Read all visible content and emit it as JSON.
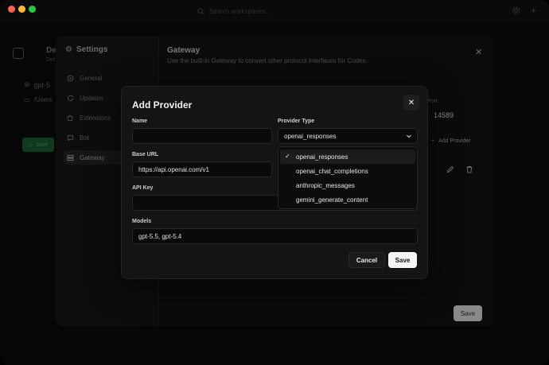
{
  "titlebar": {
    "search_placeholder": "Search workspaces...",
    "icons": [
      "search-icon",
      "gear-icon",
      "plus-icon"
    ]
  },
  "workspace": {
    "title": "De",
    "subtitle": "Def",
    "branch": "gpt-5",
    "path": "/Users",
    "start_label": "Start"
  },
  "settings": {
    "title": "Settings",
    "nav": [
      "General",
      "Updates",
      "Extensions",
      "Bot",
      "Gateway"
    ],
    "active": "Gateway"
  },
  "gateway": {
    "title": "Gateway",
    "description": "Use the built-in Gateway to convert other protocol interfaces for Codex.",
    "port_label": "Port",
    "port_value": "14589",
    "add_provider_label": "Add Provider",
    "save_label": "Save"
  },
  "modal": {
    "title": "Add Provider",
    "name_label": "Name",
    "name_value": "",
    "provider_type_label": "Provider Type",
    "provider_type_value": "openai_responses",
    "provider_options": [
      "openai_responses",
      "openai_chat_completions",
      "anthropic_messages",
      "gemini_generate_content"
    ],
    "base_url_label": "Base URL",
    "base_url_value": "https://api.openai.com/v1",
    "api_key_label": "API Key",
    "api_key_value": "",
    "models_label": "Models",
    "models_value": "gpt-5.5, gpt-5.4",
    "cancel_label": "Cancel",
    "save_label": "Save"
  }
}
